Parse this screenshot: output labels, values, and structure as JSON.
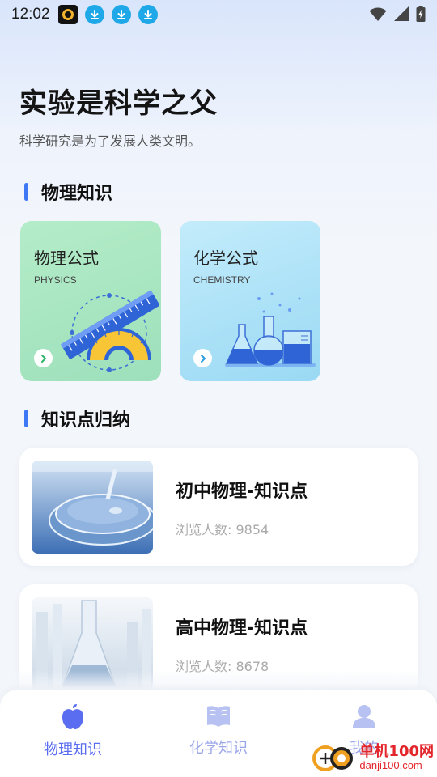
{
  "status_bar": {
    "time": "12:02"
  },
  "hero": {
    "title": "实验是科学之父",
    "subtitle": "科学研究是为了发展人类文明。"
  },
  "section_physics": {
    "title": "物理知识"
  },
  "cards": [
    {
      "title": "物理公式",
      "subtitle": "PHYSICS"
    },
    {
      "title": "化学公式",
      "subtitle": "CHEMISTRY"
    }
  ],
  "section_summary": {
    "title": "知识点归纳"
  },
  "list": [
    {
      "title": "初中物理-知识点",
      "views_label": "浏览人数:",
      "views": "9854"
    },
    {
      "title": "高中物理-知识点",
      "views_label": "浏览人数:",
      "views": "8678"
    }
  ],
  "tabs": [
    {
      "label": "物理知识",
      "icon": "apple-icon",
      "active": true
    },
    {
      "label": "化学知识",
      "icon": "book-icon",
      "active": false
    },
    {
      "label": "我的",
      "icon": "user-icon",
      "active": false
    }
  ],
  "watermark": {
    "brand": "单机100网",
    "url": "danji100.com"
  },
  "colors": {
    "accent": "#3f78f5",
    "tab_active": "#5a6cf0",
    "tab_inactive": "#9aa6ea"
  }
}
